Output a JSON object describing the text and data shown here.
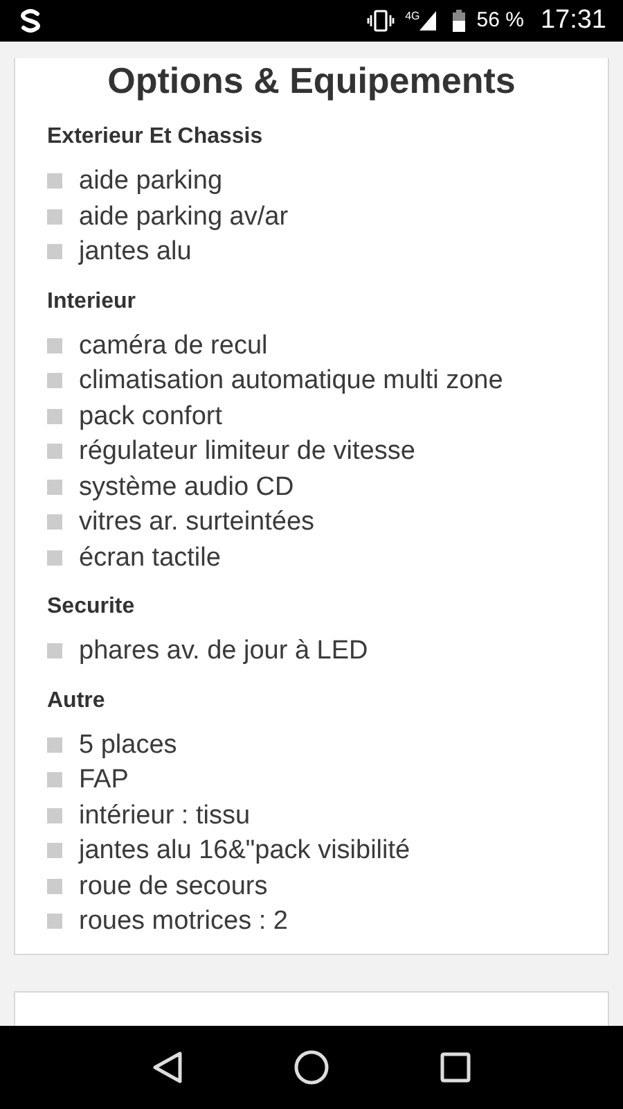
{
  "status_bar": {
    "network": "4G",
    "battery": "56 %",
    "time": "17:31"
  },
  "title": "Options & Equipements",
  "sections": [
    {
      "heading": "Exterieur Et Chassis",
      "items": [
        "aide parking",
        "aide parking av/ar",
        "jantes alu"
      ]
    },
    {
      "heading": "Interieur",
      "items": [
        "caméra de recul",
        "climatisation automatique multi zone",
        "pack confort",
        "régulateur limiteur de vitesse",
        "système audio CD",
        "vitres ar. surteintées",
        "écran tactile"
      ]
    },
    {
      "heading": "Securite",
      "items": [
        "phares av. de jour à LED"
      ]
    },
    {
      "heading": "Autre",
      "items": [
        "5 places",
        "FAP",
        "intérieur : tissu",
        "jantes alu 16&\"pack visibilité",
        "roue de secours",
        "roues motrices : 2"
      ]
    }
  ]
}
